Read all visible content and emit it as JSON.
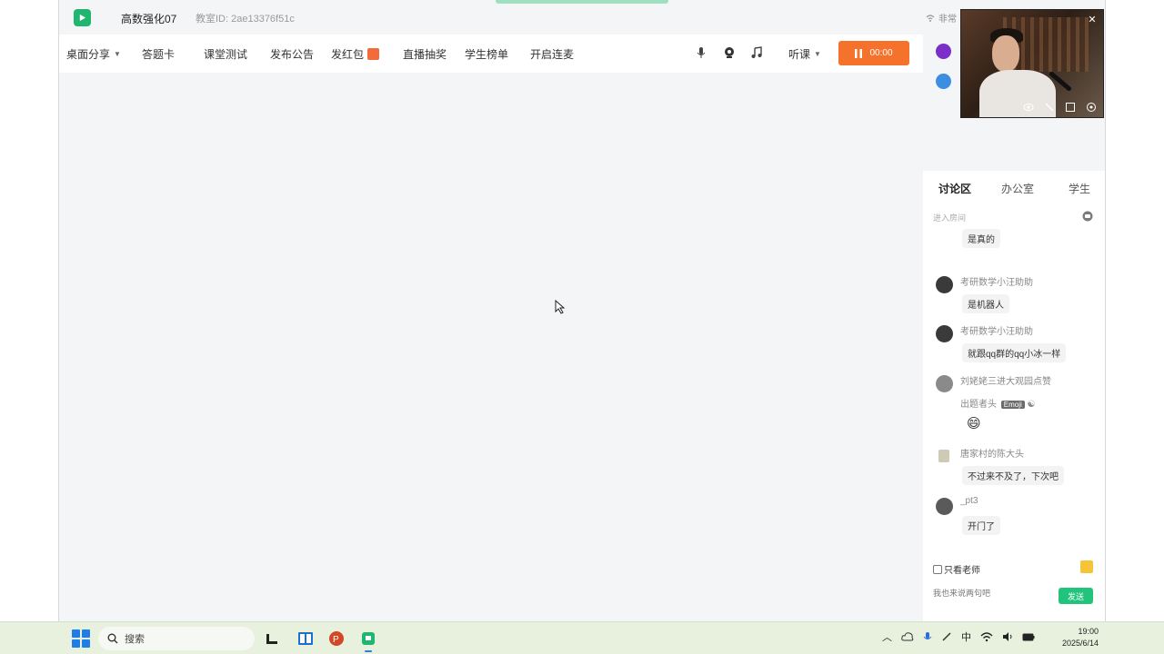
{
  "window": {
    "room_title": "高数强化07",
    "room_id": "教室ID: 2ae13376f51c",
    "network_status": "非常"
  },
  "toolbar": {
    "desktop_share": "桌面分享",
    "answer_card": "答题卡",
    "class_quiz": "课堂测试",
    "announcement": "发布公告",
    "red_packet": "发红包",
    "live_lottery": "直播抽奖",
    "student_list": "学生榜单",
    "connect_mic": "开启连麦",
    "listen": "听课",
    "live_button": "00:00"
  },
  "chat": {
    "tabs": [
      "讨论区",
      "办公室",
      "学生"
    ],
    "active_tab": "讨论区",
    "info_text": "进入房间",
    "messages": [
      {
        "name": "",
        "text": "是真的"
      },
      {
        "name": "考研数学小汪助助",
        "text": "是机器人"
      },
      {
        "name": "考研数学小汪助助",
        "text": "就跟qq群的qq小冰一样"
      },
      {
        "name": "刘姥姥三进大观园点赞",
        "text": "出题者头",
        "tag": "Emoji",
        "emoji": "😄"
      },
      {
        "name": "唐家村的陈大头",
        "text": "不过来不及了，下次吧"
      },
      {
        "name": "_pt3",
        "text": "开门了"
      }
    ],
    "only_teacher": "只看老师",
    "input_placeholder": "我也来说两句吧",
    "send": "发送"
  },
  "taskbar": {
    "search": "搜索",
    "ime": "中",
    "time": "19:00",
    "date": "2025/6/14"
  },
  "colors": {
    "brand_green": "#21b66f",
    "live_orange": "#f4722b",
    "send_green": "#21c47a",
    "taskbar_bg": "#e8f0de"
  }
}
